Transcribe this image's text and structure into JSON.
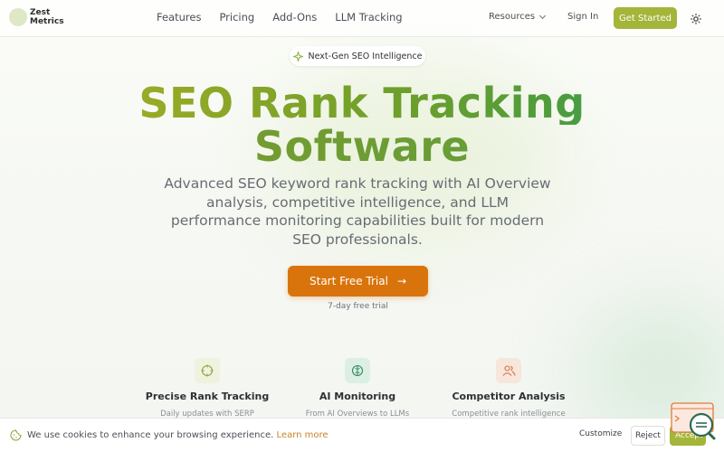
{
  "brand": {
    "name_line1": "Zest",
    "name_line2": "Metrics"
  },
  "nav": {
    "items": [
      "Features",
      "Pricing",
      "Add-Ons",
      "LLM Tracking"
    ],
    "resources": "Resources",
    "sign_in": "Sign In",
    "get_started": "Get Started"
  },
  "hero": {
    "badge": "Next-Gen SEO Intelligence",
    "title_line1": "SEO Rank Tracking",
    "title_line2": "Software",
    "subtitle": "Advanced SEO keyword rank tracking with AI Overview analysis, competitive intelligence, and LLM performance monitoring capabilities built for modern SEO professionals.",
    "cta": "Start Free Trial",
    "cta_note": "7-day free trial"
  },
  "features": [
    {
      "title": "Precise Rank Tracking",
      "desc": "Daily updates with SERP",
      "icon": "target-icon"
    },
    {
      "title": "AI Monitoring",
      "desc": "From AI Overviews to LLMs",
      "icon": "brain-icon"
    },
    {
      "title": "Competitor Analysis",
      "desc": "Competitive rank intelligence",
      "icon": "users-icon"
    }
  ],
  "cookie": {
    "text": "We use cookies to enhance your browsing experience.",
    "link": "Learn more",
    "customize": "Customize",
    "reject": "Reject",
    "accept": "Accept"
  },
  "colors": {
    "accent_green": "#a4b53a",
    "cta_orange": "#d9740c",
    "link_orange": "#c9832a"
  }
}
